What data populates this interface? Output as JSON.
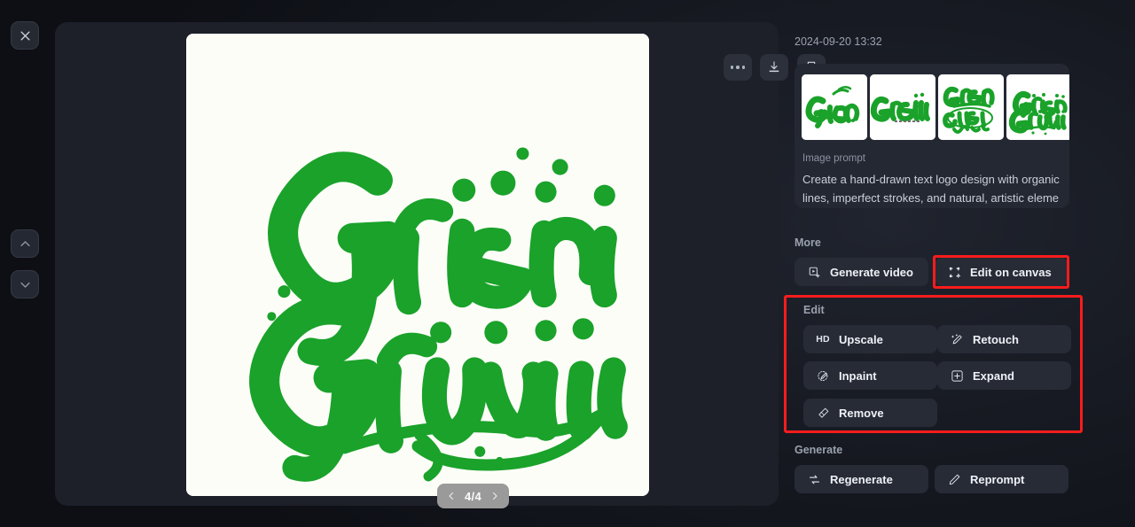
{
  "app": {
    "theme_background": "#0d0f15",
    "accent_highlight": "#f81c1c",
    "logo_green": "#1aa22a"
  },
  "left_rail": {
    "close_label": "Close",
    "prev_label": "Previous",
    "next_label": "Next"
  },
  "viewer": {
    "toolbar": {
      "more_label": "More options",
      "download_label": "Download",
      "bookmark_label": "Bookmark"
    },
    "pagination": {
      "current": 4,
      "total": 4,
      "label": "4/4",
      "prev_label": "Previous image",
      "next_label": "Next image"
    },
    "image": {
      "line1": "Grieni",
      "line2": "Gruviia",
      "alt": "Green hand-drawn script lettering logo on off-white background",
      "background": "#fdfdf8"
    }
  },
  "sidebar": {
    "timestamp": "2024-09-20 13:32",
    "prompt_card": {
      "thumbnails": [
        {
          "id": "thumb-1",
          "line1": "deecg't",
          "line2": "Gpaab"
        },
        {
          "id": "thumb-2",
          "line1": "GpkeUN",
          "line2": "a r a f i a  a >"
        },
        {
          "id": "thumb-3",
          "line1": "Green",
          "line2": "fonnioe",
          "line3": "HUCLP",
          "line4": "Wsinct"
        },
        {
          "id": "thumb-4",
          "line1": "Grieni",
          "line2": "Gruviia"
        }
      ],
      "prompt_label": "Image prompt",
      "prompt_text": "Create a hand-drawn text logo design with organic lines, imperfect strokes, and natural, artistic eleme"
    },
    "sections": [
      {
        "id": "more",
        "title": "More",
        "buttons": [
          {
            "id": "generate-video",
            "label": "Generate video",
            "icon": "video-frame-icon",
            "highlighted": false
          },
          {
            "id": "edit-on-canvas",
            "label": "Edit on canvas",
            "icon": "canvas-frame-icon",
            "highlighted": true
          }
        ]
      },
      {
        "id": "edit",
        "title": "Edit",
        "highlighted": true,
        "buttons": [
          {
            "id": "upscale",
            "label": "Upscale",
            "icon": "hd-text-icon"
          },
          {
            "id": "retouch",
            "label": "Retouch",
            "icon": "magic-wand-icon"
          },
          {
            "id": "inpaint",
            "label": "Inpaint",
            "icon": "brush-circle-icon"
          },
          {
            "id": "expand",
            "label": "Expand",
            "icon": "expand-square-icon"
          },
          {
            "id": "remove",
            "label": "Remove",
            "icon": "eraser-icon"
          }
        ]
      },
      {
        "id": "generate",
        "title": "Generate",
        "buttons": [
          {
            "id": "regenerate",
            "label": "Regenerate",
            "icon": "refresh-arrows-icon"
          },
          {
            "id": "reprompt",
            "label": "Reprompt",
            "icon": "pencil-icon"
          }
        ]
      }
    ]
  }
}
